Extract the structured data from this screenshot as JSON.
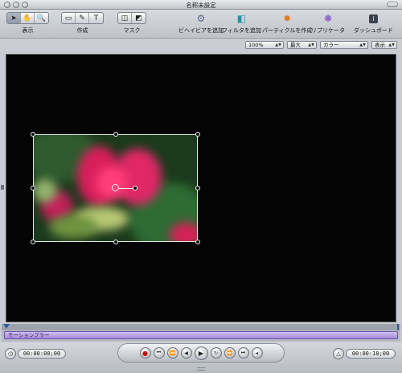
{
  "window": {
    "title": "名称未設定"
  },
  "toolbar": {
    "groups": [
      {
        "label": "表示",
        "tools": [
          "select-arrow-icon",
          "hand-icon",
          "zoom-icon"
        ]
      },
      {
        "label": "作成",
        "tools": [
          "rectangle-icon",
          "bezier-pen-icon",
          "text-icon"
        ]
      },
      {
        "label": "マスク",
        "tools": [
          "rect-mask-icon",
          "bezier-mask-icon"
        ]
      }
    ],
    "actions": [
      {
        "label": "ビヘイビアを追加",
        "icon": "gear-icon"
      },
      {
        "label": "フィルタを追加",
        "icon": "filter-icon"
      },
      {
        "label": "パーティクルを作成",
        "icon": "particle-icon"
      },
      {
        "label": "リプリケータ",
        "icon": "replicator-icon"
      },
      {
        "label": "ダッシュボード",
        "icon": "info-icon"
      }
    ]
  },
  "canvas_options": {
    "zoom": "100%",
    "resolution": "最大",
    "channels": "カラー",
    "view": "表示"
  },
  "timeline": {
    "layer_bar_label": "モーションブラー"
  },
  "transport": {
    "current_timecode": "00:00:00;00",
    "duration_timecode": "00:00:10;00",
    "buttons": [
      "record",
      "go-to-start",
      "step-back",
      "play-reverse",
      "play",
      "loop",
      "step-forward",
      "go-to-end",
      "audio"
    ]
  },
  "colors": {
    "accent": "#2a5ca8",
    "layer_bar": "#b7a0e3",
    "record": "#c21313"
  }
}
